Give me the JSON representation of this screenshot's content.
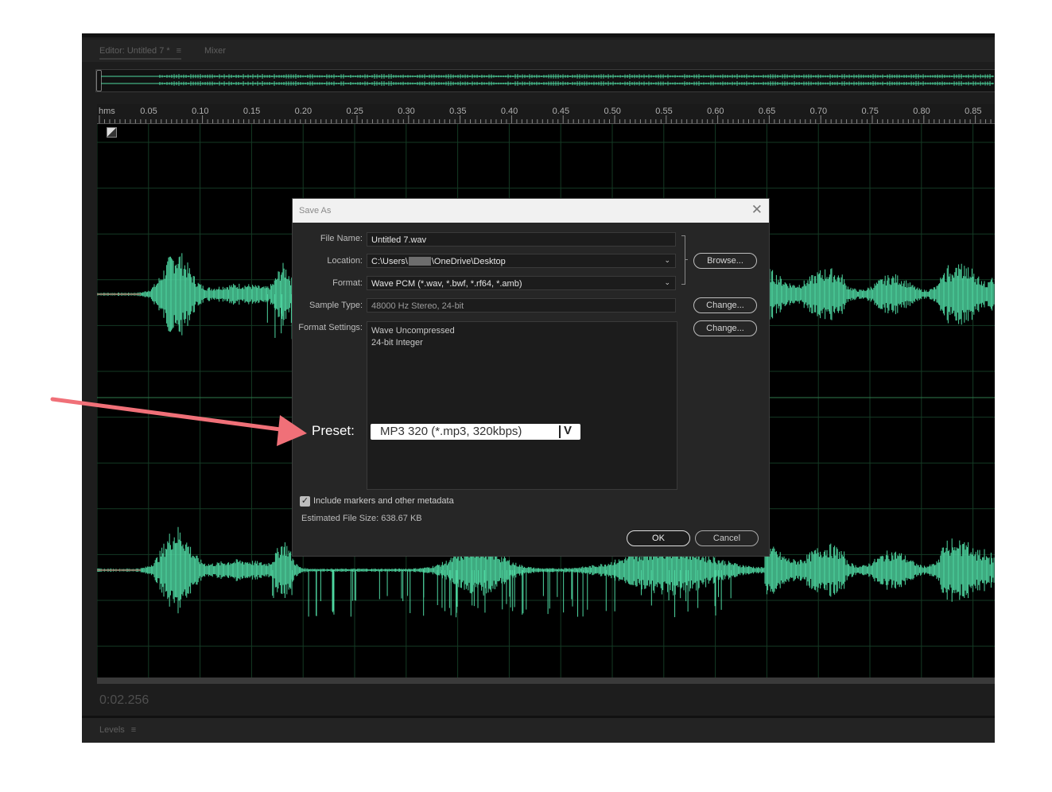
{
  "editor": {
    "tabs": {
      "editor_label": "Editor: Untitled 7 *",
      "editor_menu_icon": "hamburger-icon",
      "mixer_label": "Mixer"
    },
    "ruler": {
      "unit": "hms",
      "ticks": [
        "0.05",
        "0.10",
        "0.15",
        "0.20",
        "0.25",
        "0.30",
        "0.35",
        "0.40",
        "0.45",
        "0.50",
        "0.55",
        "0.60",
        "0.65",
        "0.70",
        "0.75",
        "0.80",
        "0.85"
      ]
    },
    "timecode": "0:02.256",
    "levels_label": "Levels",
    "waveform_color": "#4ed6a0"
  },
  "dialog": {
    "title": "Save As",
    "file_name_label": "File Name:",
    "file_name_value": "Untitled 7.wav",
    "location_label": "Location:",
    "location_prefix": "C:\\Users\\",
    "location_suffix": "\\OneDrive\\Desktop",
    "format_label": "Format:",
    "format_value": "Wave PCM (*.wav, *.bwf, *.rf64, *.amb)",
    "sample_type_label": "Sample Type:",
    "sample_type_value": "48000 Hz Stereo, 24-bit",
    "format_settings_label": "Format Settings:",
    "format_settings_line1": "Wave Uncompressed",
    "format_settings_line2": "24-bit Integer",
    "browse_label": "Browse...",
    "change_label_1": "Change...",
    "change_label_2": "Change...",
    "include_markers_label": "Include markers and other metadata",
    "include_markers_checked": true,
    "estimated_size": "Estimated File Size: 638.67 KB",
    "ok_label": "OK",
    "cancel_label": "Cancel"
  },
  "annotation": {
    "preset_label": "Preset:",
    "preset_value": "MP3 320 (*.mp3, 320kbps)",
    "arrow_color": "#f07078"
  }
}
